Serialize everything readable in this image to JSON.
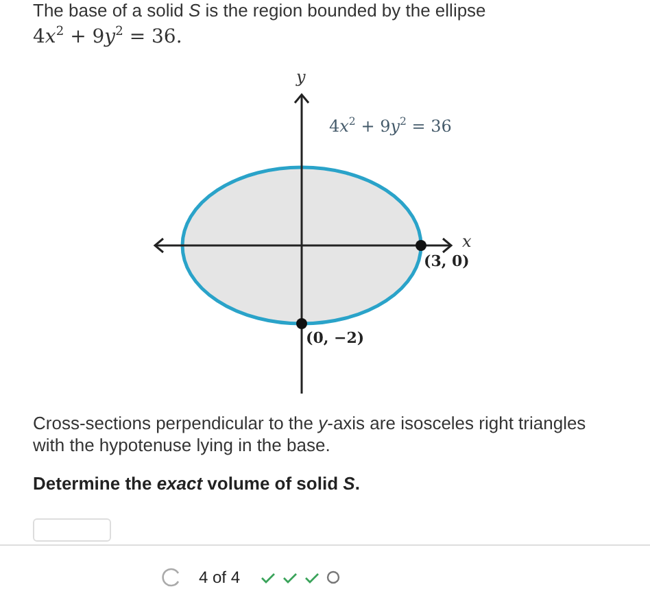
{
  "intro": "The base of a solid *S* is the region bounded by the ellipse",
  "equation": [
    {
      "kind": "num",
      "text": "4"
    },
    {
      "kind": "var",
      "text": "x"
    },
    {
      "kind": "sup",
      "text": "2"
    },
    {
      "kind": "num",
      "text": " + 9"
    },
    {
      "kind": "var",
      "text": "y"
    },
    {
      "kind": "sup",
      "text": "2"
    },
    {
      "kind": "num",
      "text": " = 36."
    }
  ],
  "graph": {
    "y_axis_label": "y",
    "x_axis_label": "x",
    "curve_label": [
      {
        "kind": "num",
        "text": "4"
      },
      {
        "kind": "var",
        "text": "x"
      },
      {
        "kind": "sup",
        "text": "2"
      },
      {
        "kind": "num",
        "text": " + 9"
      },
      {
        "kind": "var",
        "text": "y"
      },
      {
        "kind": "sup",
        "text": "2"
      },
      {
        "kind": "num",
        "text": " = 36"
      }
    ],
    "point_right_label": "(3, 0)",
    "point_bottom_label": "(0, −2)"
  },
  "description": "Cross-sections perpendicular to the *y*-axis are isosceles right triangles with the hypotenuse lying in the base.",
  "question": "Determine the *exact* volume of solid *S*.",
  "footer": {
    "counter": "4 of 4",
    "steps": [
      {
        "completed": true
      },
      {
        "completed": true
      },
      {
        "completed": true
      },
      {
        "completed": false
      }
    ]
  }
}
